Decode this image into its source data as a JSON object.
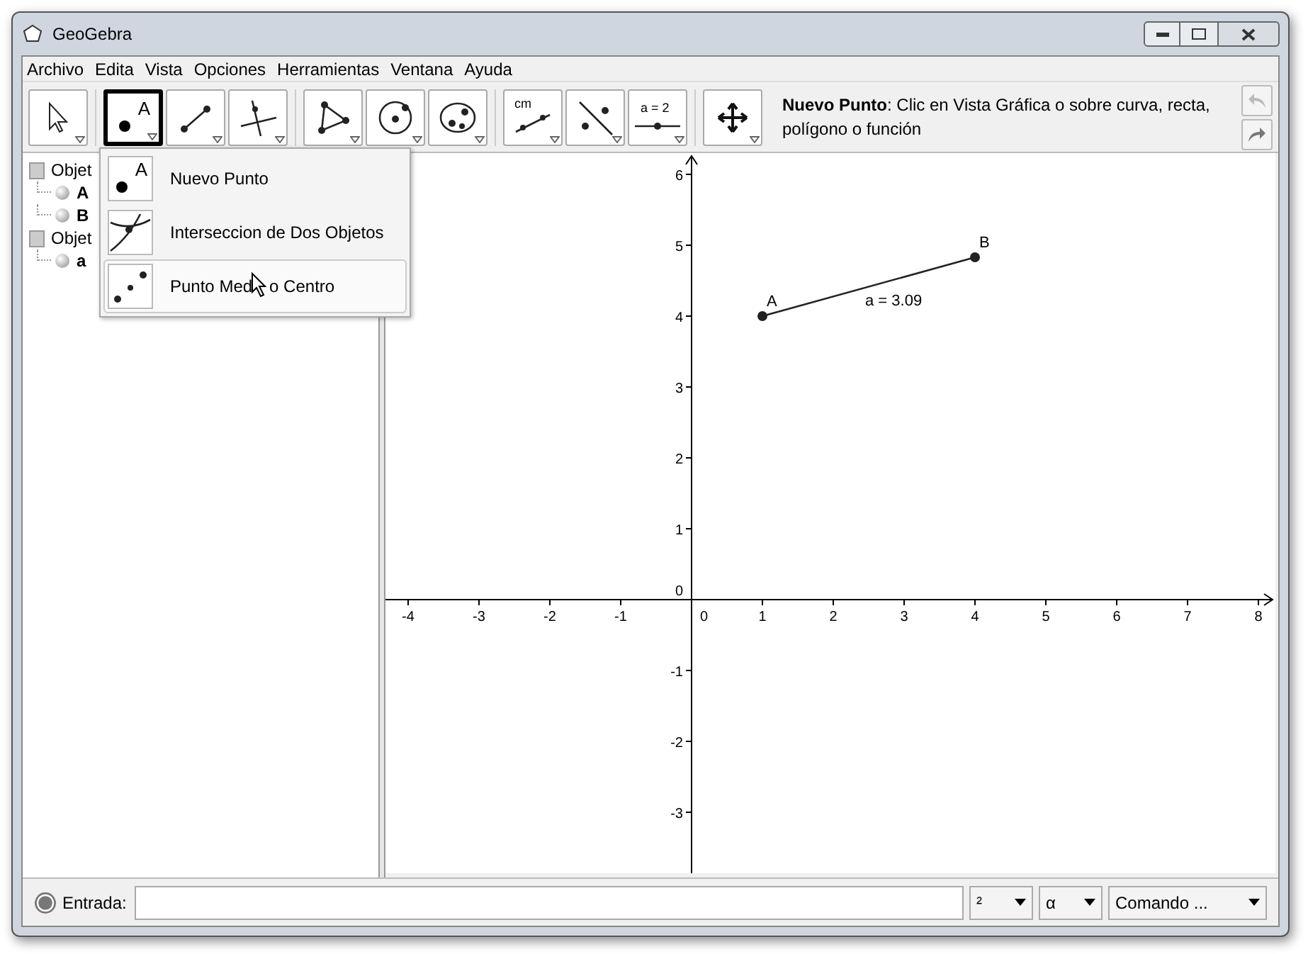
{
  "window": {
    "title": "GeoGebra"
  },
  "menu": [
    "Archivo",
    "Edita",
    "Vista",
    "Opciones",
    "Herramientas",
    "Ventana",
    "Ayuda"
  ],
  "toolbar": {
    "groups": [
      {
        "tools": [
          {
            "kind": "move",
            "selected": false
          }
        ]
      },
      {
        "tools": [
          {
            "kind": "point",
            "label": "A",
            "selected": true
          },
          {
            "kind": "segment",
            "selected": false
          },
          {
            "kind": "perpendicular",
            "selected": false
          }
        ]
      },
      {
        "tools": [
          {
            "kind": "polygon",
            "selected": false
          },
          {
            "kind": "circle",
            "selected": false
          },
          {
            "kind": "conic",
            "selected": false
          }
        ]
      },
      {
        "tools": [
          {
            "kind": "measure",
            "label": "cm",
            "selected": false
          },
          {
            "kind": "line",
            "selected": false
          },
          {
            "kind": "slider",
            "label": "a = 2",
            "selected": false
          }
        ]
      },
      {
        "tools": [
          {
            "kind": "pan",
            "selected": false
          }
        ]
      }
    ],
    "help": "**Nuevo Punto**: Clic en Vista Gráfica o sobre curva, recta, polígono o función"
  },
  "tool_menu": [
    {
      "kind": "point",
      "icon_label": "A",
      "label": "Nuevo Punto",
      "selected": false
    },
    {
      "kind": "intersect",
      "label": "Interseccion de Dos Objetos",
      "selected": false
    },
    {
      "kind": "midpoint",
      "label": "Punto Med",
      "label_after": "o Centro",
      "selected": true
    }
  ],
  "algebra": [
    {
      "label": "Objet",
      "expanded": true,
      "children": [
        {
          "label": "A"
        },
        {
          "label": "B"
        }
      ]
    },
    {
      "label": "Objet",
      "expanded": true,
      "children": [
        {
          "label": "a"
        }
      ]
    }
  ],
  "graphics": {
    "x_ticks": [
      "-4",
      "-3",
      "-2",
      "-1",
      "0",
      "1",
      "2",
      "3",
      "4",
      "5",
      "6",
      "7",
      "8"
    ],
    "y_ticks": [
      "6",
      "5",
      "4",
      "3",
      "2",
      "1",
      "0",
      "-1",
      "-2",
      "-3"
    ],
    "points": [
      {
        "label": "A"
      },
      {
        "label": "B"
      }
    ],
    "segment_label": "a = 3.09"
  },
  "input_bar": {
    "label": "Entrada:",
    "buttons": [
      "²",
      "α",
      "Comando ..."
    ]
  }
}
